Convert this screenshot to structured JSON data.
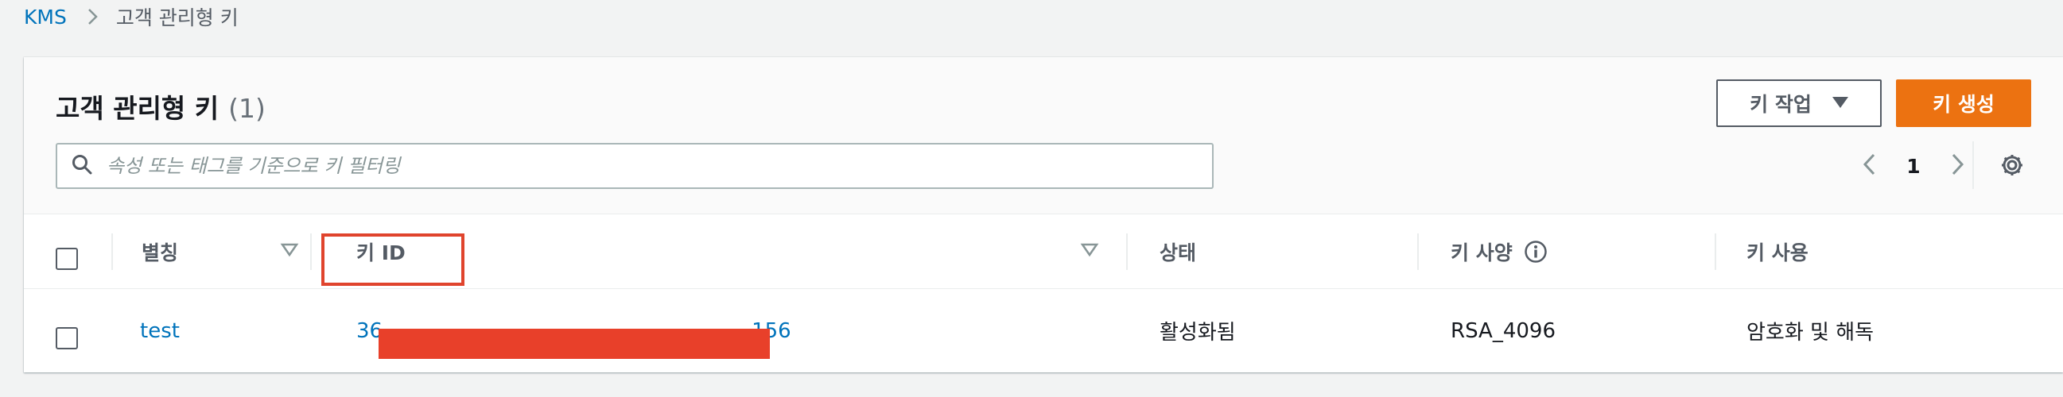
{
  "breadcrumb": {
    "root": "KMS",
    "current": "고객 관리형 키"
  },
  "header": {
    "title": "고객 관리형 키",
    "count": "(1)",
    "actions_label": "키 작업",
    "create_label": "키 생성"
  },
  "search": {
    "placeholder": "속성 또는 태그를 기준으로 키 필터링",
    "value": ""
  },
  "pagination": {
    "current_page": "1"
  },
  "table": {
    "columns": [
      "별칭",
      "키 ID",
      "상태",
      "키 사양",
      "키 사용"
    ],
    "rows": [
      {
        "alias": "test",
        "key_id_prefix": "36",
        "key_id_suffix": "156",
        "status": "활성화됨",
        "spec": "RSA_4096",
        "usage": "암호화 및 해독"
      }
    ]
  },
  "colors": {
    "link": "#0073bb",
    "primary_button": "#ec7211",
    "redaction": "#e8402a",
    "highlight_box": "#e0442d"
  },
  "icons": [
    "chevron-right-icon",
    "search-icon",
    "caret-down-icon",
    "chevron-left-icon",
    "gear-icon",
    "sort-icon",
    "info-icon"
  ]
}
